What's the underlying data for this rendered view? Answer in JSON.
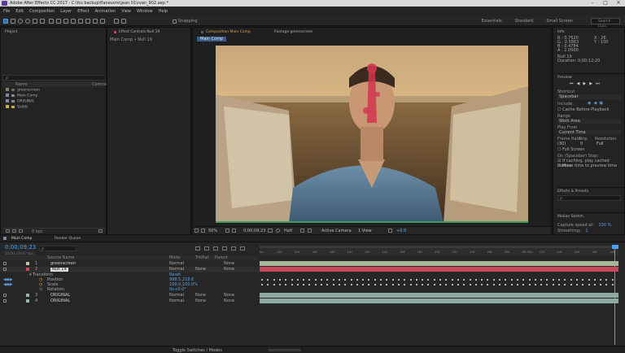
{
  "window": {
    "title": "Adobe After Effects CC 2017 - C:\\fcs backup\\flaneuvre\\jean 01\\rvan_902.aep *"
  },
  "menu": [
    "File",
    "Edit",
    "Composition",
    "Layer",
    "Effect",
    "Animation",
    "View",
    "Window",
    "Help"
  ],
  "toolbar": {
    "snapping": "Snapping"
  },
  "workspaces": [
    "Essentials",
    "Standard",
    "Small Screen"
  ],
  "search_help": "Search Help",
  "project": {
    "tab": "Project",
    "search_placeholder": "ρ",
    "col_name": "Name",
    "col_comment": "Comment",
    "items": [
      {
        "name": "greenscreen",
        "color": "#7a8a6a"
      },
      {
        "name": "Main Comp",
        "color": "#7a8aa8"
      },
      {
        "name": "ORIGINAL",
        "color": "#7a8aa8"
      },
      {
        "name": "Solids",
        "color": "#c9b13c"
      }
    ],
    "bpc": "8 bpc"
  },
  "effect_controls": {
    "tab": "Effect Controls Null 19",
    "subtitle": "Main Comp • Null 19"
  },
  "composition": {
    "tab": "Composition Main Comp",
    "footage_tab": "Footage greenscreen",
    "comp_label": "Main Comp",
    "zoom": "50%",
    "timecode": "0;00;09;23",
    "resolution": "Half",
    "camera": "Active Camera",
    "views": "1 View",
    "exposure": "+0.0"
  },
  "info": {
    "tab": "Info",
    "r": "R : 0.7620",
    "g": "G : 0.5863",
    "b": "B : 0.4784",
    "a": "A : 1.0000",
    "x": "X : 26",
    "y": "Y : 100",
    "layer": "Null 19",
    "duration": "Duration: 0;00;12;20"
  },
  "preview": {
    "tab": "Preview",
    "shortcut_label": "Shortcut",
    "shortcut_value": "Spacebar",
    "include_label": "Include:",
    "cache": "Cache Before Playback",
    "range_label": "Range",
    "range_value": "Work Area",
    "playfrom_label": "Play From",
    "playfrom_value": "Current Time",
    "framerate_label": "Frame Rate",
    "skip_label": "Skip",
    "res_label": "Resolution",
    "framerate_value": "(30)",
    "skip_value": "0",
    "res_value": "Full",
    "fullscreen": "Full Screen",
    "onstop_label": "On (Spacebar) Stop:",
    "ifcaching": "If caching, play cached frames",
    "movetime": "Move time to preview time"
  },
  "effects_presets": {
    "tab": "Effects & Presets",
    "search": "ρ"
  },
  "motion_sketch": {
    "tab": "Motion Sketch",
    "capture": "Capture speed at:",
    "capture_value": "100 %",
    "smoothing": "Smoothing:",
    "smoothing_value": "1"
  },
  "timeline": {
    "tab": "Main Comp",
    "render_queue": "Render Queue",
    "timecode": "0;00;09;23",
    "timecode_sub": "00293 (29.97 fps)",
    "col_source": "Source Name",
    "col_mode": "Mode",
    "col_trkmat": "TrkMat",
    "col_parent": "Parent",
    "layers": [
      {
        "num": "1",
        "name": "greenscreen",
        "mode": "Normal",
        "trk": "",
        "parent": "None",
        "color": "#b8c7a8"
      },
      {
        "num": "2",
        "name": "Null 19",
        "mode": "Normal",
        "trk": "None",
        "parent": "None",
        "color": "#c9465c"
      },
      {
        "num": "3",
        "name": "ORIGINAL",
        "mode": "Normal",
        "trk": "None",
        "parent": "None",
        "color": "#9ab5b0"
      },
      {
        "num": "4",
        "name": "ORIGINAL",
        "mode": "Normal",
        "trk": "None",
        "parent": "None",
        "color": "#9ab5b0"
      }
    ],
    "transform": "Transform",
    "reset": "Reset",
    "position_label": "Position",
    "position_value": "998.5,218.6",
    "scale_label": "Scale",
    "scale_value": "100.0,100.0%",
    "rotation_label": "Rotation",
    "rotation_value": "0x+0.0°",
    "ruler_ticks": [
      "0s",
      "02f",
      "04f",
      "06f",
      "08f",
      "10f",
      "12f",
      "14f",
      "16f",
      "18f",
      "20f",
      "22f",
      "24f",
      "26f",
      "28f",
      "00:00s",
      "02f",
      "04f",
      "06f",
      "08f",
      "10f"
    ],
    "toggle": "Toggle Switches / Modes"
  }
}
